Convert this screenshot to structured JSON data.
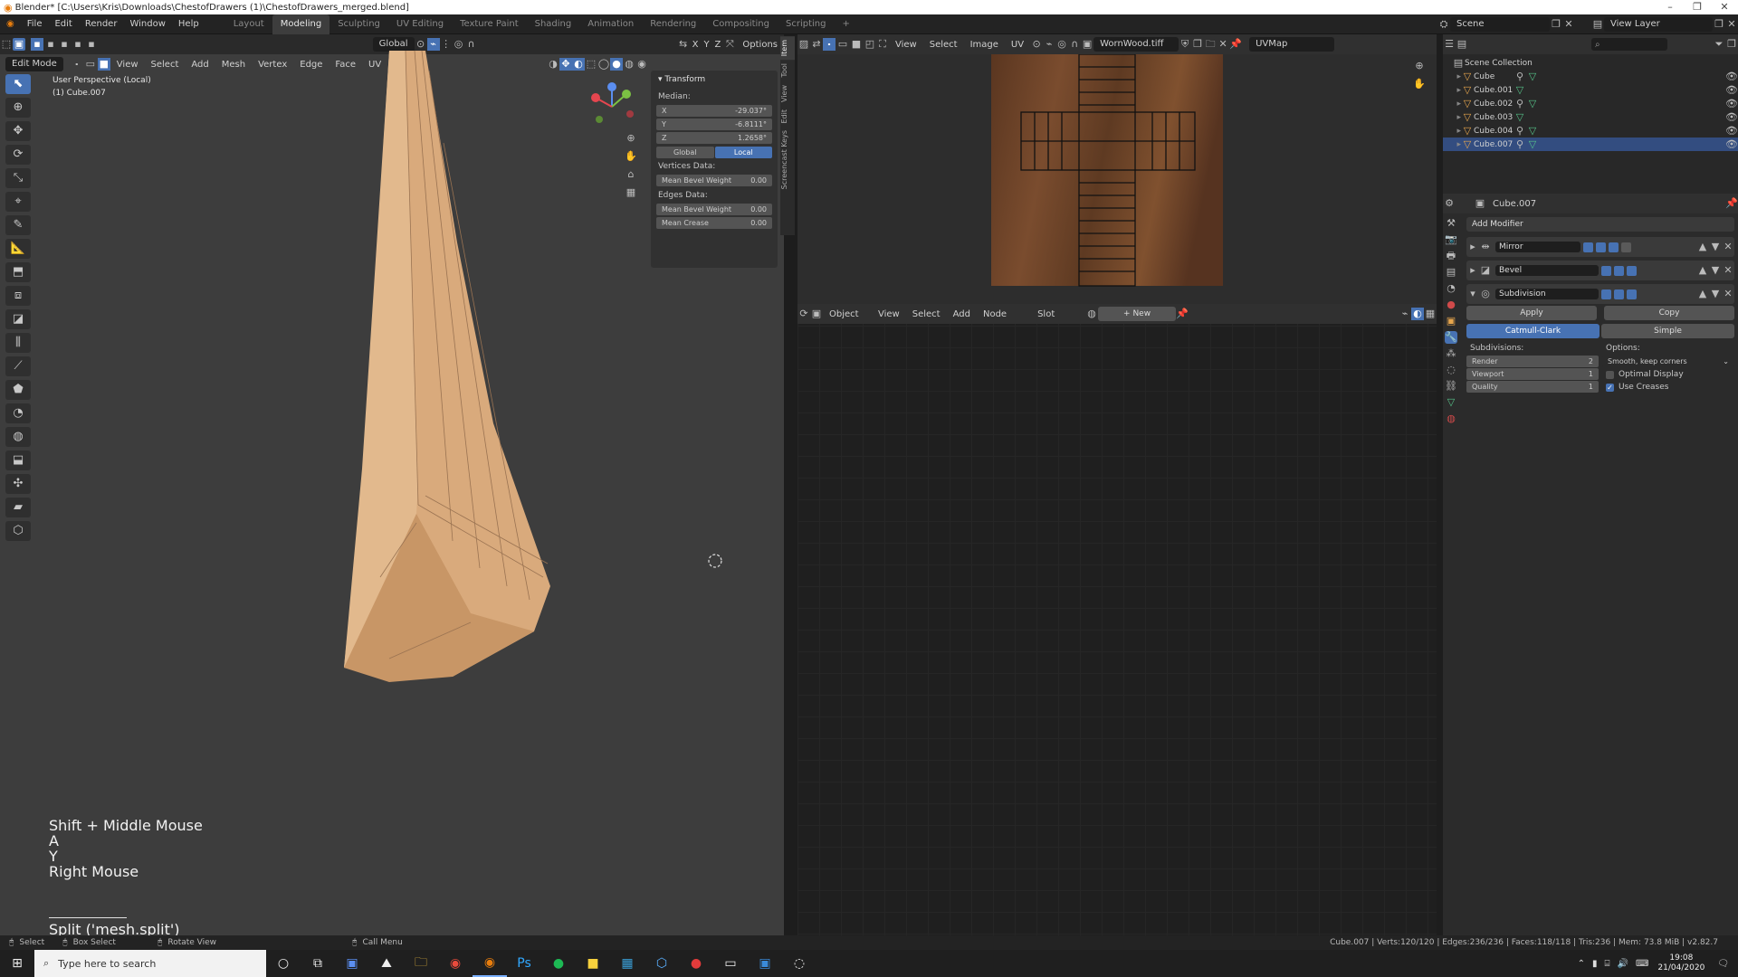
{
  "window": {
    "title": "Blender* [C:\\Users\\Kris\\Downloads\\ChestofDrawers (1)\\ChestofDrawers_merged.blend]"
  },
  "menus": [
    "File",
    "Edit",
    "Render",
    "Window",
    "Help"
  ],
  "workspaces": [
    "Layout",
    "Modeling",
    "Sculpting",
    "UV Editing",
    "Texture Paint",
    "Shading",
    "Animation",
    "Rendering",
    "Compositing",
    "Scripting"
  ],
  "active_workspace": "Modeling",
  "scene": "Scene",
  "view_layer": "View Layer",
  "viewport": {
    "mode": "Edit Mode",
    "menus": [
      "View",
      "Select",
      "Add",
      "Mesh",
      "Vertex",
      "Edge",
      "Face",
      "UV"
    ],
    "orientation": "Global",
    "options_label": "Options",
    "axes": [
      "X",
      "Y",
      "Z"
    ],
    "view_name": "User Perspective (Local)",
    "object_name": "(1) Cube.007"
  },
  "npanel": {
    "section": "Transform",
    "median_label": "Median:",
    "x_label": "X",
    "x": "-29.037°",
    "y_label": "Y",
    "y": "-6.8111°",
    "z_label": "Z",
    "z": "1.2658°",
    "global_label": "Global",
    "local_label": "Local",
    "vertices_label": "Vertices Data:",
    "v_bevel_label": "Mean Bevel Weight",
    "v_bevel": "0.00",
    "edges_label": "Edges Data:",
    "e_bevel_label": "Mean Bevel Weight",
    "e_bevel": "0.00",
    "crease_label": "Mean Crease",
    "crease": "0.00",
    "tabs": [
      "Item",
      "Tool",
      "View",
      "Edit",
      "Screencast Keys"
    ]
  },
  "keys_overlay": [
    "Shift + Middle Mouse",
    "A",
    "Y",
    "Right Mouse"
  ],
  "operator": "Split ('mesh.split')",
  "image_editor": {
    "menus": [
      "View",
      "Select",
      "Image",
      "UV"
    ],
    "image_name": "WornWood.tiff",
    "uvmap": "UVMap"
  },
  "node_editor": {
    "type": "Object",
    "menus": [
      "View",
      "Select",
      "Add",
      "Node"
    ],
    "slot": "Slot",
    "new_label": "New"
  },
  "outliner": {
    "collection": "Scene Collection",
    "items": [
      "Cube",
      "Cube.001",
      "Cube.002",
      "Cube.003",
      "Cube.004",
      "Cube.007"
    ],
    "selected": "Cube.007"
  },
  "properties": {
    "object": "Cube.007",
    "add_modifier": "Add Modifier",
    "modifiers": [
      "Mirror",
      "Bevel",
      "Subdivision"
    ],
    "apply_label": "Apply",
    "copy_label": "Copy",
    "catmull_label": "Catmull-Clark",
    "simple_label": "Simple",
    "subdivisions_label": "Subdivisions:",
    "options_label": "Options:",
    "render_label": "Render",
    "render": "2",
    "viewport_label": "Viewport",
    "viewport": "1",
    "quality_label": "Quality",
    "quality": "1",
    "uv_smooth": "Smooth, keep corners",
    "optimal_display": "Optimal Display",
    "use_creases": "Use Creases"
  },
  "statusbar": {
    "select": "Select",
    "box_select": "Box Select",
    "rotate_view": "Rotate View",
    "call_menu": "Call Menu",
    "stats": "Cube.007 | Verts:120/120 | Edges:236/236 | Faces:118/118 | Tris:236 | Mem: 73.8 MiB | v2.82.7"
  },
  "taskbar": {
    "search_placeholder": "Type here to search",
    "time": "19:08",
    "date": "21/04/2020"
  },
  "colors": {
    "accent": "#4772b3",
    "mesh": "#d8a97c",
    "wood": "#6b4329"
  }
}
